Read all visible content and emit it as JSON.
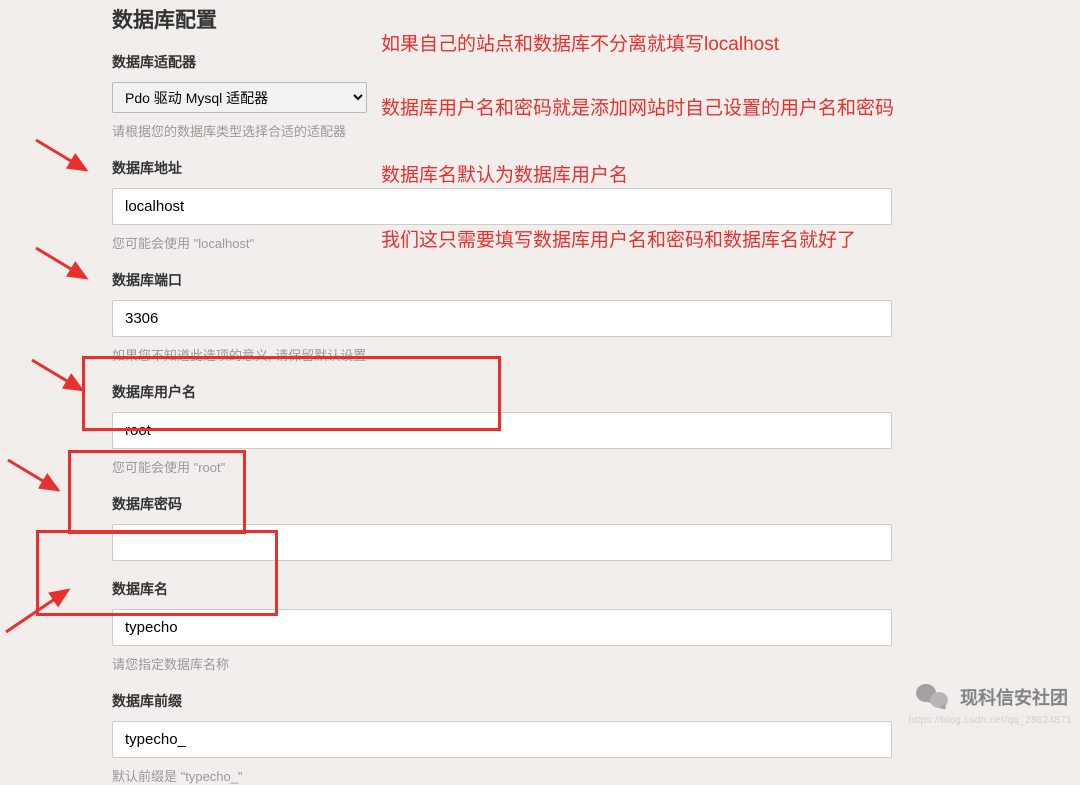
{
  "title": "数据库配置",
  "adapter": {
    "label": "数据库适配器",
    "value": "Pdo 驱动 Mysql 适配器",
    "hint": "请根据您的数据库类型选择合适的适配器"
  },
  "host": {
    "label": "数据库地址",
    "value": "localhost",
    "hint": "您可能会使用 \"localhost\""
  },
  "port": {
    "label": "数据库端口",
    "value": "3306",
    "hint": "如果您不知道此选项的意义, 请保留默认设置"
  },
  "user": {
    "label": "数据库用户名",
    "value": "root",
    "hint": "您可能会使用 \"root\""
  },
  "password": {
    "label": "数据库密码",
    "value": ""
  },
  "dbname": {
    "label": "数据库名",
    "value": "typecho",
    "hint": "请您指定数据库名称"
  },
  "prefix": {
    "label": "数据库前缀",
    "value": "typecho_",
    "hint": "默认前缀是 \"typecho_\""
  },
  "annotations": {
    "a1": "如果自己的站点和数据库不分离就填写localhost",
    "a2": "数据库用户名和密码就是添加网站时自己设置的用户名和密码",
    "a3": "数据库名默认为数据库用户名",
    "a4": "我们这只需要填写数据库用户名和密码和数据库名就好了"
  },
  "watermark": {
    "text": "现科信安社团",
    "url": "https://blog.csdn.net/qq_28624871"
  }
}
